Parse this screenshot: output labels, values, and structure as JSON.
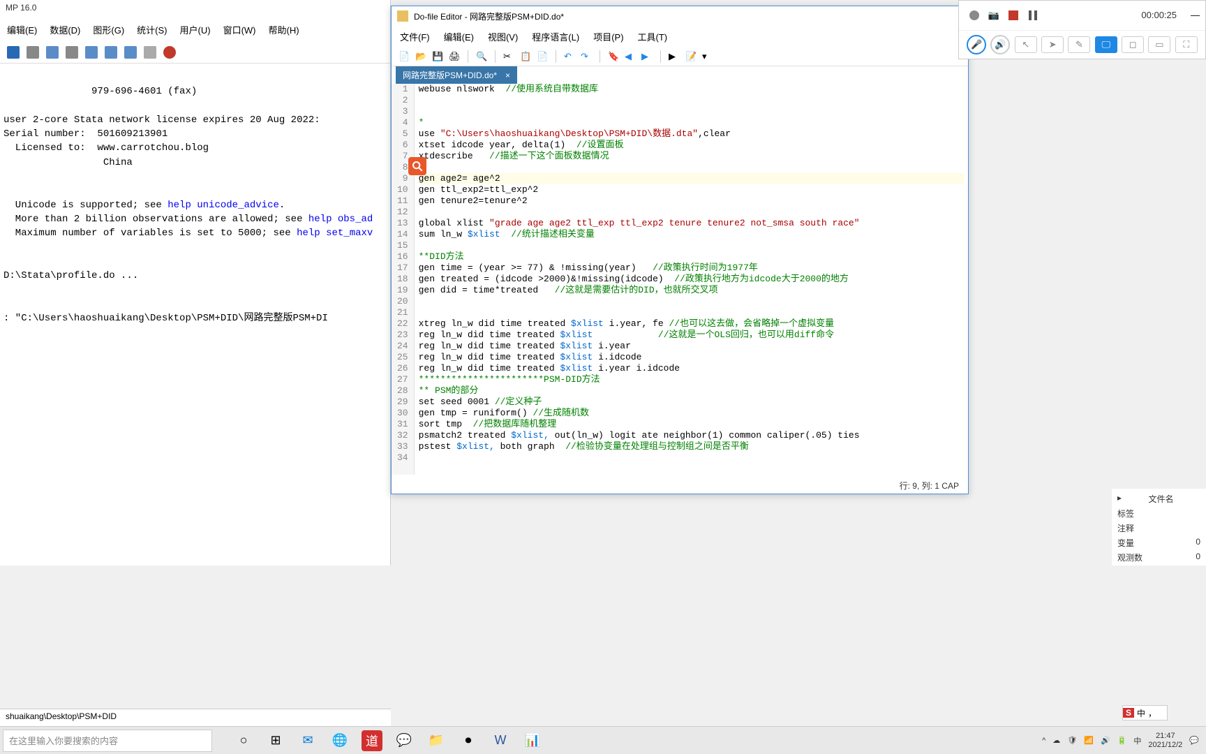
{
  "stata": {
    "title": "MP 16.0",
    "menu": [
      "编辑(E)",
      "数据(D)",
      "图形(G)",
      "统计(S)",
      "用户(U)",
      "窗口(W)",
      "帮助(H)"
    ],
    "results": {
      "fax": "               979-696-4601 (fax)",
      "license": "user 2-core Stata network license expires 20 Aug 2022:",
      "serial_label": "Serial number:",
      "serial_value": "  501609213901",
      "licensed_label": "  Licensed to:",
      "licensed_value": "  www.carrotchou.blog",
      "country": "                 China",
      "unicode": "  Unicode is supported; see ",
      "unicode_link": "help unicode_advice",
      "obs": "  More than 2 billion observations are allowed; see ",
      "obs_link": "help obs_ad",
      "maxvar": "  Maximum number of variables is set to 5000; see ",
      "maxvar_link": "help set_maxv",
      "profile": "D:\\Stata\\profile.do ...",
      "cmd_echo": ": \"C:\\Users\\haoshuaikang\\Desktop\\PSM+DID\\网路完整版PSM+DI"
    },
    "path": "shuaikang\\Desktop\\PSM+DID"
  },
  "dofile": {
    "title": "Do-file Editor - 网路完整版PSM+DID.do*",
    "menu": [
      "文件(F)",
      "编辑(E)",
      "视图(V)",
      "程序语言(L)",
      "项目(P)",
      "工具(T)"
    ],
    "tab": "网路完整版PSM+DID.do*",
    "status": "行: 9, 列: 1  CAP",
    "lines": [
      {
        "n": 1,
        "parts": [
          {
            "t": "webuse nlswork  ",
            "c": ""
          },
          {
            "t": "//使用系统自带数据库",
            "c": "cmt"
          }
        ]
      },
      {
        "n": 2,
        "parts": []
      },
      {
        "n": 3,
        "parts": []
      },
      {
        "n": 4,
        "parts": [
          {
            "t": "*",
            "c": "cmt"
          }
        ]
      },
      {
        "n": 5,
        "parts": [
          {
            "t": "use ",
            "c": ""
          },
          {
            "t": "\"C:\\Users\\haoshuaikang\\Desktop\\PSM+DID\\数据.dta\"",
            "c": "str"
          },
          {
            "t": ",clear",
            "c": ""
          }
        ]
      },
      {
        "n": 6,
        "parts": [
          {
            "t": "xtset idcode year, delta(1)  ",
            "c": ""
          },
          {
            "t": "//设置面板",
            "c": "cmt"
          }
        ]
      },
      {
        "n": 7,
        "parts": [
          {
            "t": "xtdescribe   ",
            "c": ""
          },
          {
            "t": "//描述一下这个面板数据情况",
            "c": "cmt"
          }
        ]
      },
      {
        "n": 8,
        "parts": []
      },
      {
        "n": 9,
        "parts": [
          {
            "t": "gen age2= age^2",
            "c": ""
          }
        ],
        "hl": true
      },
      {
        "n": 10,
        "parts": [
          {
            "t": "gen ttl_exp2=ttl_exp^2",
            "c": ""
          }
        ]
      },
      {
        "n": 11,
        "parts": [
          {
            "t": "gen tenure2=tenure^2",
            "c": ""
          }
        ]
      },
      {
        "n": 12,
        "parts": []
      },
      {
        "n": 13,
        "parts": [
          {
            "t": "global xlist ",
            "c": ""
          },
          {
            "t": "\"grade age age2 ttl_exp ttl_exp2 tenure tenure2 not_smsa south race\"",
            "c": "str"
          }
        ]
      },
      {
        "n": 14,
        "parts": [
          {
            "t": "sum ln_w ",
            "c": ""
          },
          {
            "t": "$xlist",
            "c": "var"
          },
          {
            "t": "  ",
            "c": ""
          },
          {
            "t": "//统计描述相关变量",
            "c": "cmt"
          }
        ]
      },
      {
        "n": 15,
        "parts": []
      },
      {
        "n": 16,
        "parts": [
          {
            "t": "**DID方法",
            "c": "cmt"
          }
        ]
      },
      {
        "n": 17,
        "parts": [
          {
            "t": "gen time = (year >= 77) & !missing(year)   ",
            "c": ""
          },
          {
            "t": "//政策执行时间为1977年",
            "c": "cmt"
          }
        ]
      },
      {
        "n": 18,
        "parts": [
          {
            "t": "gen treated = (idcode >2000)&!missing(idcode)  ",
            "c": ""
          },
          {
            "t": "//政策执行地方为idcode大于2000的地方",
            "c": "cmt"
          }
        ]
      },
      {
        "n": 19,
        "parts": [
          {
            "t": "gen did = time*treated   ",
            "c": ""
          },
          {
            "t": "//这就是需要估计的DID，也就所交叉项",
            "c": "cmt"
          }
        ]
      },
      {
        "n": 20,
        "parts": []
      },
      {
        "n": 21,
        "parts": []
      },
      {
        "n": 22,
        "parts": [
          {
            "t": "xtreg ln_w did time treated ",
            "c": ""
          },
          {
            "t": "$xlist",
            "c": "var"
          },
          {
            "t": " i.year, fe ",
            "c": ""
          },
          {
            "t": "//也可以这去做，会省略掉一个虚拟变量",
            "c": "cmt"
          }
        ]
      },
      {
        "n": 23,
        "parts": [
          {
            "t": "reg ln_w did time treated ",
            "c": ""
          },
          {
            "t": "$xlist",
            "c": "var"
          },
          {
            "t": "            ",
            "c": ""
          },
          {
            "t": "//这就是一个OLS回归，也可以用diff命令",
            "c": "cmt"
          }
        ]
      },
      {
        "n": 24,
        "parts": [
          {
            "t": "reg ln_w did time treated ",
            "c": ""
          },
          {
            "t": "$xlist",
            "c": "var"
          },
          {
            "t": " i.year",
            "c": ""
          }
        ]
      },
      {
        "n": 25,
        "parts": [
          {
            "t": "reg ln_w did time treated ",
            "c": ""
          },
          {
            "t": "$xlist",
            "c": "var"
          },
          {
            "t": " i.idcode",
            "c": ""
          }
        ]
      },
      {
        "n": 26,
        "parts": [
          {
            "t": "reg ln_w did time treated ",
            "c": ""
          },
          {
            "t": "$xlist",
            "c": "var"
          },
          {
            "t": " i.year i.idcode",
            "c": ""
          }
        ]
      },
      {
        "n": 27,
        "parts": [
          {
            "t": "***********************PSM-DID方法",
            "c": "cmt"
          }
        ]
      },
      {
        "n": 28,
        "parts": [
          {
            "t": "** PSM的部分",
            "c": "cmt"
          }
        ]
      },
      {
        "n": 29,
        "parts": [
          {
            "t": "set seed 0001 ",
            "c": ""
          },
          {
            "t": "//定义种子",
            "c": "cmt"
          }
        ]
      },
      {
        "n": 30,
        "parts": [
          {
            "t": "gen tmp = runiform() ",
            "c": ""
          },
          {
            "t": "//生成随机数",
            "c": "cmt"
          }
        ]
      },
      {
        "n": 31,
        "parts": [
          {
            "t": "sort tmp  ",
            "c": ""
          },
          {
            "t": "//把数据库随机整理",
            "c": "cmt"
          }
        ]
      },
      {
        "n": 32,
        "parts": [
          {
            "t": "psmatch2 treated ",
            "c": ""
          },
          {
            "t": "$xlist,",
            "c": "var"
          },
          {
            "t": " out(ln_w) logit ate neighbor(1) common caliper(.05) ties",
            "c": ""
          }
        ]
      },
      {
        "n": 33,
        "parts": [
          {
            "t": "pstest ",
            "c": ""
          },
          {
            "t": "$xlist,",
            "c": "var"
          },
          {
            "t": " both graph  ",
            "c": ""
          },
          {
            "t": "//检验协变量在处理组与控制组之间是否平衡",
            "c": "cmt"
          }
        ]
      },
      {
        "n": 34,
        "parts": []
      }
    ]
  },
  "recorder": {
    "timer": "00:00:25"
  },
  "props": {
    "filename": "文件名",
    "tags": "标签",
    "notes": "注释",
    "vars": "变量",
    "vars_val": "0",
    "obs": "观测数",
    "obs_val": "0"
  },
  "taskbar": {
    "search_placeholder": "在这里输入你要搜索的内容",
    "time": "21:47",
    "date": "2021/12/2",
    "ime": "中"
  }
}
